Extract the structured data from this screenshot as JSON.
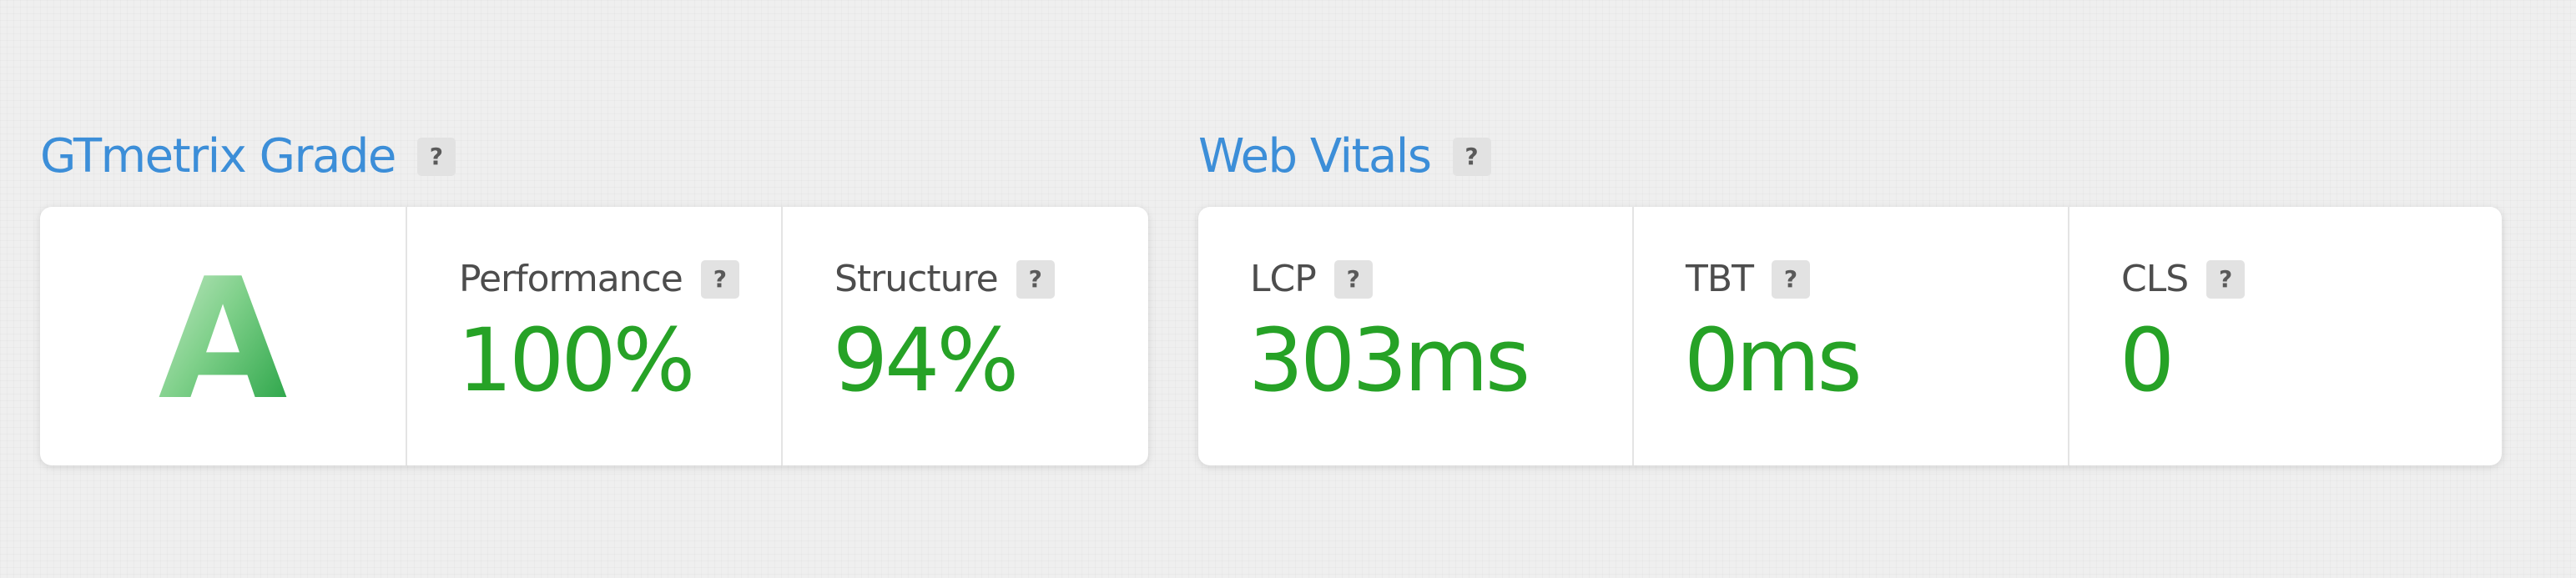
{
  "grade_section": {
    "title": "GTmetrix Grade",
    "help": "?",
    "grade": "A",
    "metrics": [
      {
        "label": "Performance",
        "help": "?",
        "value": "100%"
      },
      {
        "label": "Structure",
        "help": "?",
        "value": "94%"
      }
    ]
  },
  "vitals_section": {
    "title": "Web Vitals",
    "help": "?",
    "metrics": [
      {
        "label": "LCP",
        "help": "?",
        "value": "303ms"
      },
      {
        "label": "TBT",
        "help": "?",
        "value": "0ms"
      },
      {
        "label": "CLS",
        "help": "?",
        "value": "0"
      }
    ]
  },
  "colors": {
    "title_blue": "#3c8ed8",
    "value_green": "#26a226",
    "grade_green": "#2aa84a"
  }
}
